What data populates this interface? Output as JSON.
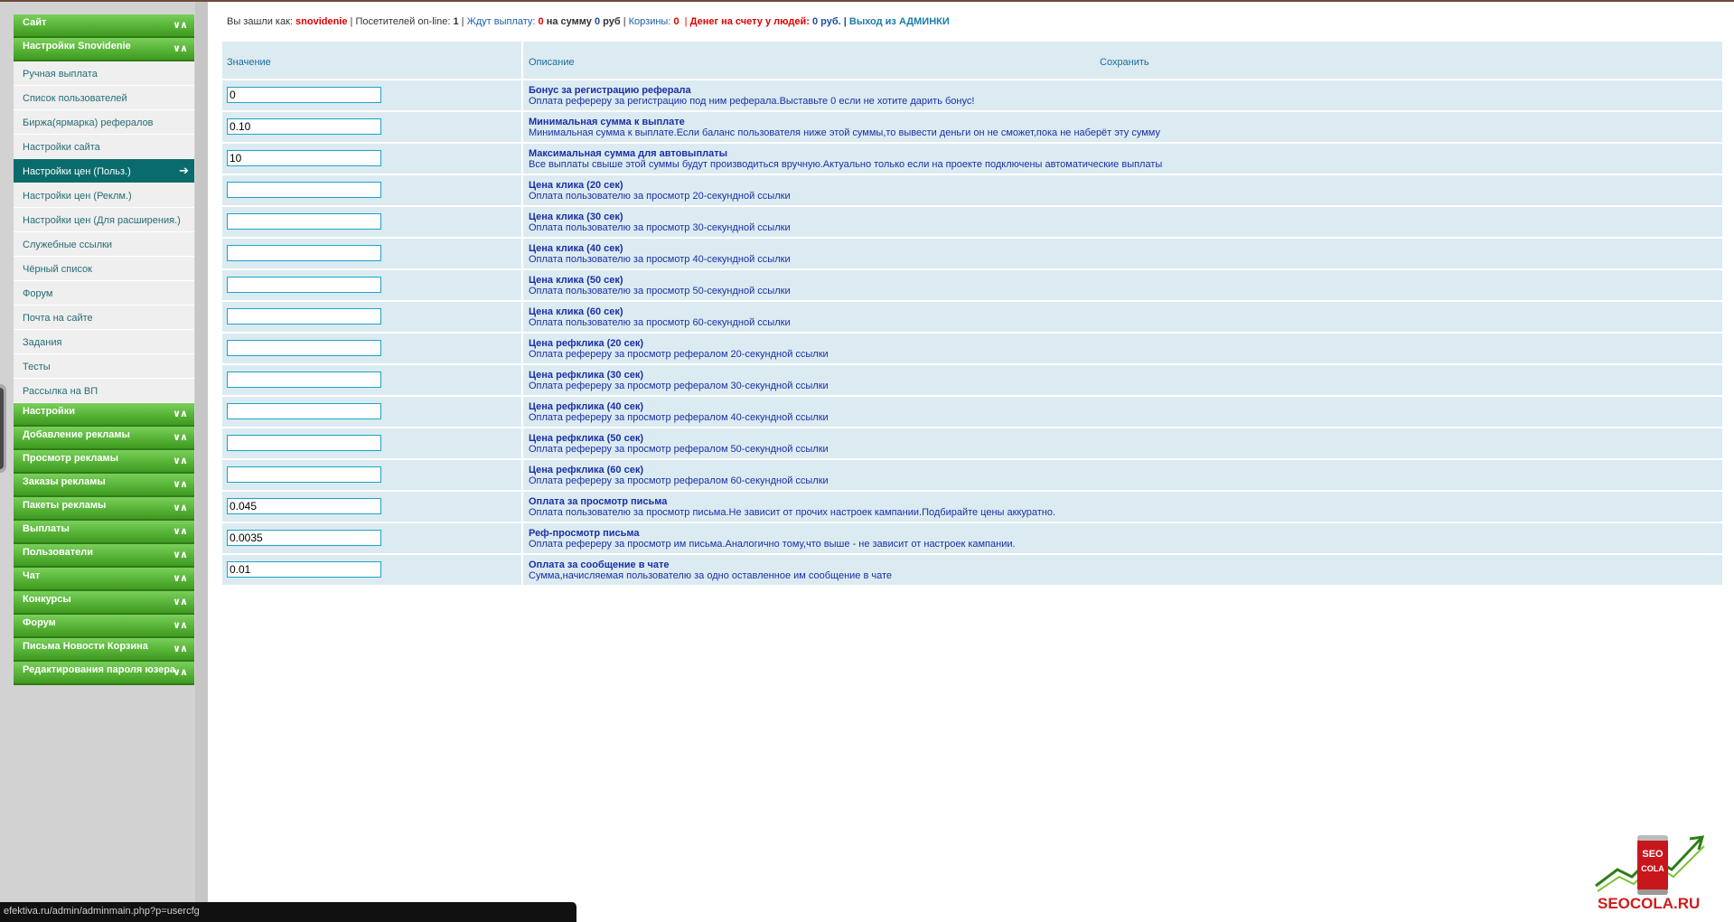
{
  "header": {
    "logged_as_label": "Вы зашли как:",
    "username": "snovidenie",
    "online_label": "Посетителей on-line:",
    "online_count": "1",
    "pending_label": "Ждут выплату:",
    "pending_count": "0",
    "sum_label": "на сумму",
    "sum_value": "0",
    "sum_unit": "руб",
    "carts_label": "Корзины:",
    "carts_count": "0",
    "money_label": "Денег на счету у людей:",
    "money_value": "0 руб.",
    "logout_label": "Выход из АДМИНКИ"
  },
  "sidebar": {
    "top_sections": [
      {
        "label": "Сайт"
      },
      {
        "label": "Настройки Snovidenie"
      }
    ],
    "items": [
      {
        "label": "Ручная выплата"
      },
      {
        "label": "Список пользователей"
      },
      {
        "label": "Биржа(ярмарка) рефералов"
      },
      {
        "label": "Настройки сайта"
      },
      {
        "label": "Настройки цен (Польз.)",
        "active": true
      },
      {
        "label": "Настройки цен (Реклм.)"
      },
      {
        "label": "Настройки цен (Для расширения.)"
      },
      {
        "label": "Служебные ссылки"
      },
      {
        "label": "Чёрный список"
      },
      {
        "label": "Форум"
      },
      {
        "label": "Почта на сайте"
      },
      {
        "label": "Задания"
      },
      {
        "label": "Тесты"
      },
      {
        "label": "Рассылка на ВП"
      }
    ],
    "bottom_sections": [
      {
        "label": "Настройки"
      },
      {
        "label": "Добавление рекламы"
      },
      {
        "label": "Просмотр рекламы"
      },
      {
        "label": "Заказы рекламы"
      },
      {
        "label": "Пакеты рекламы"
      },
      {
        "label": "Выплаты"
      },
      {
        "label": "Пользователи"
      },
      {
        "label": "Чат"
      },
      {
        "label": "Конкурсы"
      },
      {
        "label": "Форум"
      },
      {
        "label": "Письма Новости Корзина"
      },
      {
        "label": "Редактирования пароля юзера"
      }
    ]
  },
  "table": {
    "col_value": "Значение",
    "col_description": "Описание",
    "save_label": "Сохранить",
    "rows": [
      {
        "value": "0",
        "title": "Бонус за регистрацию реферала",
        "desc": "Оплата рефереру за регистрацию под ним реферала.Выставьте 0 если не хотите дарить бонус!"
      },
      {
        "value": "0.10",
        "title": "Минимальная сумма к выплате",
        "desc": "Минимальная сумма к выплате.Если баланс пользователя ниже этой суммы,то вывести деньги он не сможет,пока не наберёт эту сумму"
      },
      {
        "value": "10",
        "title": "Максимальная сумма для автовыплаты",
        "desc": "Все выплаты свыше этой суммы будут производиться вручную.Актуально только если на проекте подключены автоматические выплаты"
      },
      {
        "value": "",
        "title": "Цена клика (20 сек)",
        "desc": "Оплата пользователю за просмотр 20-секундной ссылки"
      },
      {
        "value": "",
        "title": "Цена клика (30 сек)",
        "desc": "Оплата пользователю за просмотр 30-секундной ссылки"
      },
      {
        "value": "",
        "title": "Цена клика (40 сек)",
        "desc": "Оплата пользователю за просмотр 40-секундной ссылки"
      },
      {
        "value": "",
        "title": "Цена клика (50 сек)",
        "desc": "Оплата пользователю за просмотр 50-секундной ссылки"
      },
      {
        "value": "",
        "title": "Цена клика (60 сек)",
        "desc": "Оплата пользователю за просмотр 60-секундной ссылки"
      },
      {
        "value": "",
        "title": "Цена рефклика (20 сек)",
        "desc": "Оплата рефереру за просмотр рефералом 20-секундной ссылки"
      },
      {
        "value": "",
        "title": "Цена рефклика (30 сек)",
        "desc": "Оплата рефереру за просмотр рефералом 30-секундной ссылки"
      },
      {
        "value": "",
        "title": "Цена рефклика (40 сек)",
        "desc": "Оплата рефереру за просмотр рефералом 40-секундной ссылки"
      },
      {
        "value": "",
        "title": "Цена рефклика (50 сек)",
        "desc": "Оплата рефереру за просмотр рефералом 50-секундной ссылки"
      },
      {
        "value": "",
        "title": "Цена рефклика (60 сек)",
        "desc": "Оплата рефереру за просмотр рефералом 60-секундной ссылки"
      },
      {
        "value": "0.045",
        "title": "Оплата за просмотр письма",
        "desc": "Оплата пользователю за просмотр письма.Не зависит от прочих настроек кампании.Подбирайте цены аккуратно."
      },
      {
        "value": "0.0035",
        "title": "Реф-просмотр письма",
        "desc": "Оплата рефереру за просмотр им письма.Аналогично тому,что выше - не зависит от настроек кампании."
      },
      {
        "value": "0.01",
        "title": "Оплата за сообщение в чате",
        "desc": "Сумма,начисляемая пользователю за одно оставленное им сообщение в чате"
      }
    ]
  },
  "statusbar": {
    "url": "efektiva.ru/admin/adminmain.php?p=usercfg"
  },
  "logo": {
    "top_text": "SEO",
    "can_text": "COLA",
    "bottom_text": "SEOCOLA.RU"
  },
  "icons": {
    "section_toggle": "double-chevron-icon",
    "active_arrow": "arrow-right-icon"
  }
}
